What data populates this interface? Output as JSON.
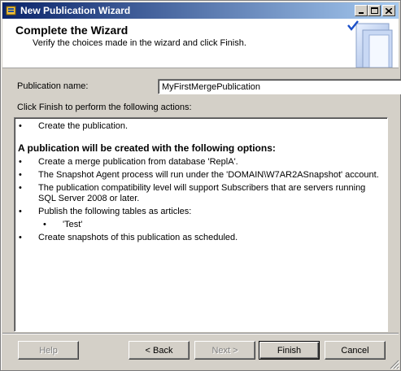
{
  "window": {
    "title": "New Publication Wizard"
  },
  "header": {
    "title": "Complete the Wizard",
    "subtitle": "Verify the choices made in the wizard and click Finish."
  },
  "form": {
    "publication_name_label": "Publication name:",
    "publication_name_value": "MyFirstMergePublication",
    "actions_label": "Click Finish to perform the following actions:"
  },
  "actions": {
    "first_item": "Create the publication.",
    "options_heading": "A publication will be created with the following options:",
    "items": [
      "Create a merge publication from database 'ReplA'.",
      "The Snapshot Agent process will run under the 'DOMAIN\\W7AR2ASnapshot' account.",
      "The publication compatibility level will support Subscribers that are servers running SQL Server 2008 or later.",
      "Publish the following tables as articles:"
    ],
    "sub_items": [
      "'Test'"
    ],
    "last_item": "Create snapshots of this publication as scheduled."
  },
  "buttons": {
    "help": "Help",
    "back": "< Back",
    "next": "Next >",
    "finish": "Finish",
    "cancel": "Cancel"
  },
  "colors": {
    "titlebar_start": "#0a246a",
    "titlebar_end": "#a6caf0",
    "face": "#d4d0c8"
  }
}
